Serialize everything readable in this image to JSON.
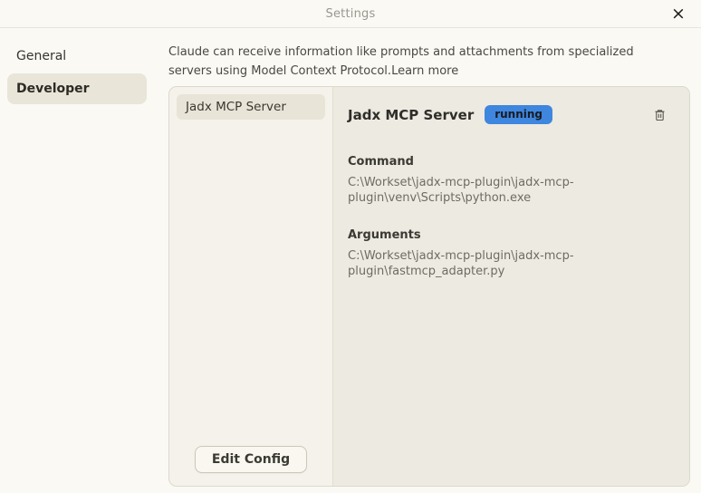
{
  "window": {
    "title": "Settings",
    "close_icon": "×"
  },
  "sidebar": {
    "items": [
      {
        "label": "General",
        "selected": false
      },
      {
        "label": "Developer",
        "selected": true
      }
    ]
  },
  "description": {
    "text": "Claude can receive information like prompts and attachments from specialized servers using Model Context Protocol.",
    "learn_more": "Learn more"
  },
  "server_list": {
    "items": [
      {
        "label": "Jadx MCP Server",
        "selected": true
      }
    ],
    "edit_config_label": "Edit Config"
  },
  "server_detail": {
    "name": "Jadx MCP Server",
    "status": "running",
    "command_label": "Command",
    "command_value": "C:\\Workset\\jadx-mcp-plugin\\jadx-mcp-plugin\\venv\\Scripts\\python.exe",
    "arguments_label": "Arguments",
    "arguments_value": "C:\\Workset\\jadx-mcp-plugin\\jadx-mcp-plugin\\fastmcp_adapter.py",
    "delete_icon": "trash-icon"
  },
  "colors": {
    "window_bg": "#faf9f4",
    "card_left_bg": "#f4f2ea",
    "card_right_bg": "#edeae1",
    "selected_item_bg": "#e9e5d8",
    "status_badge_bg": "#3e86de",
    "card_border": "#dcd8cc",
    "secondary_text": "#6f6c62"
  }
}
